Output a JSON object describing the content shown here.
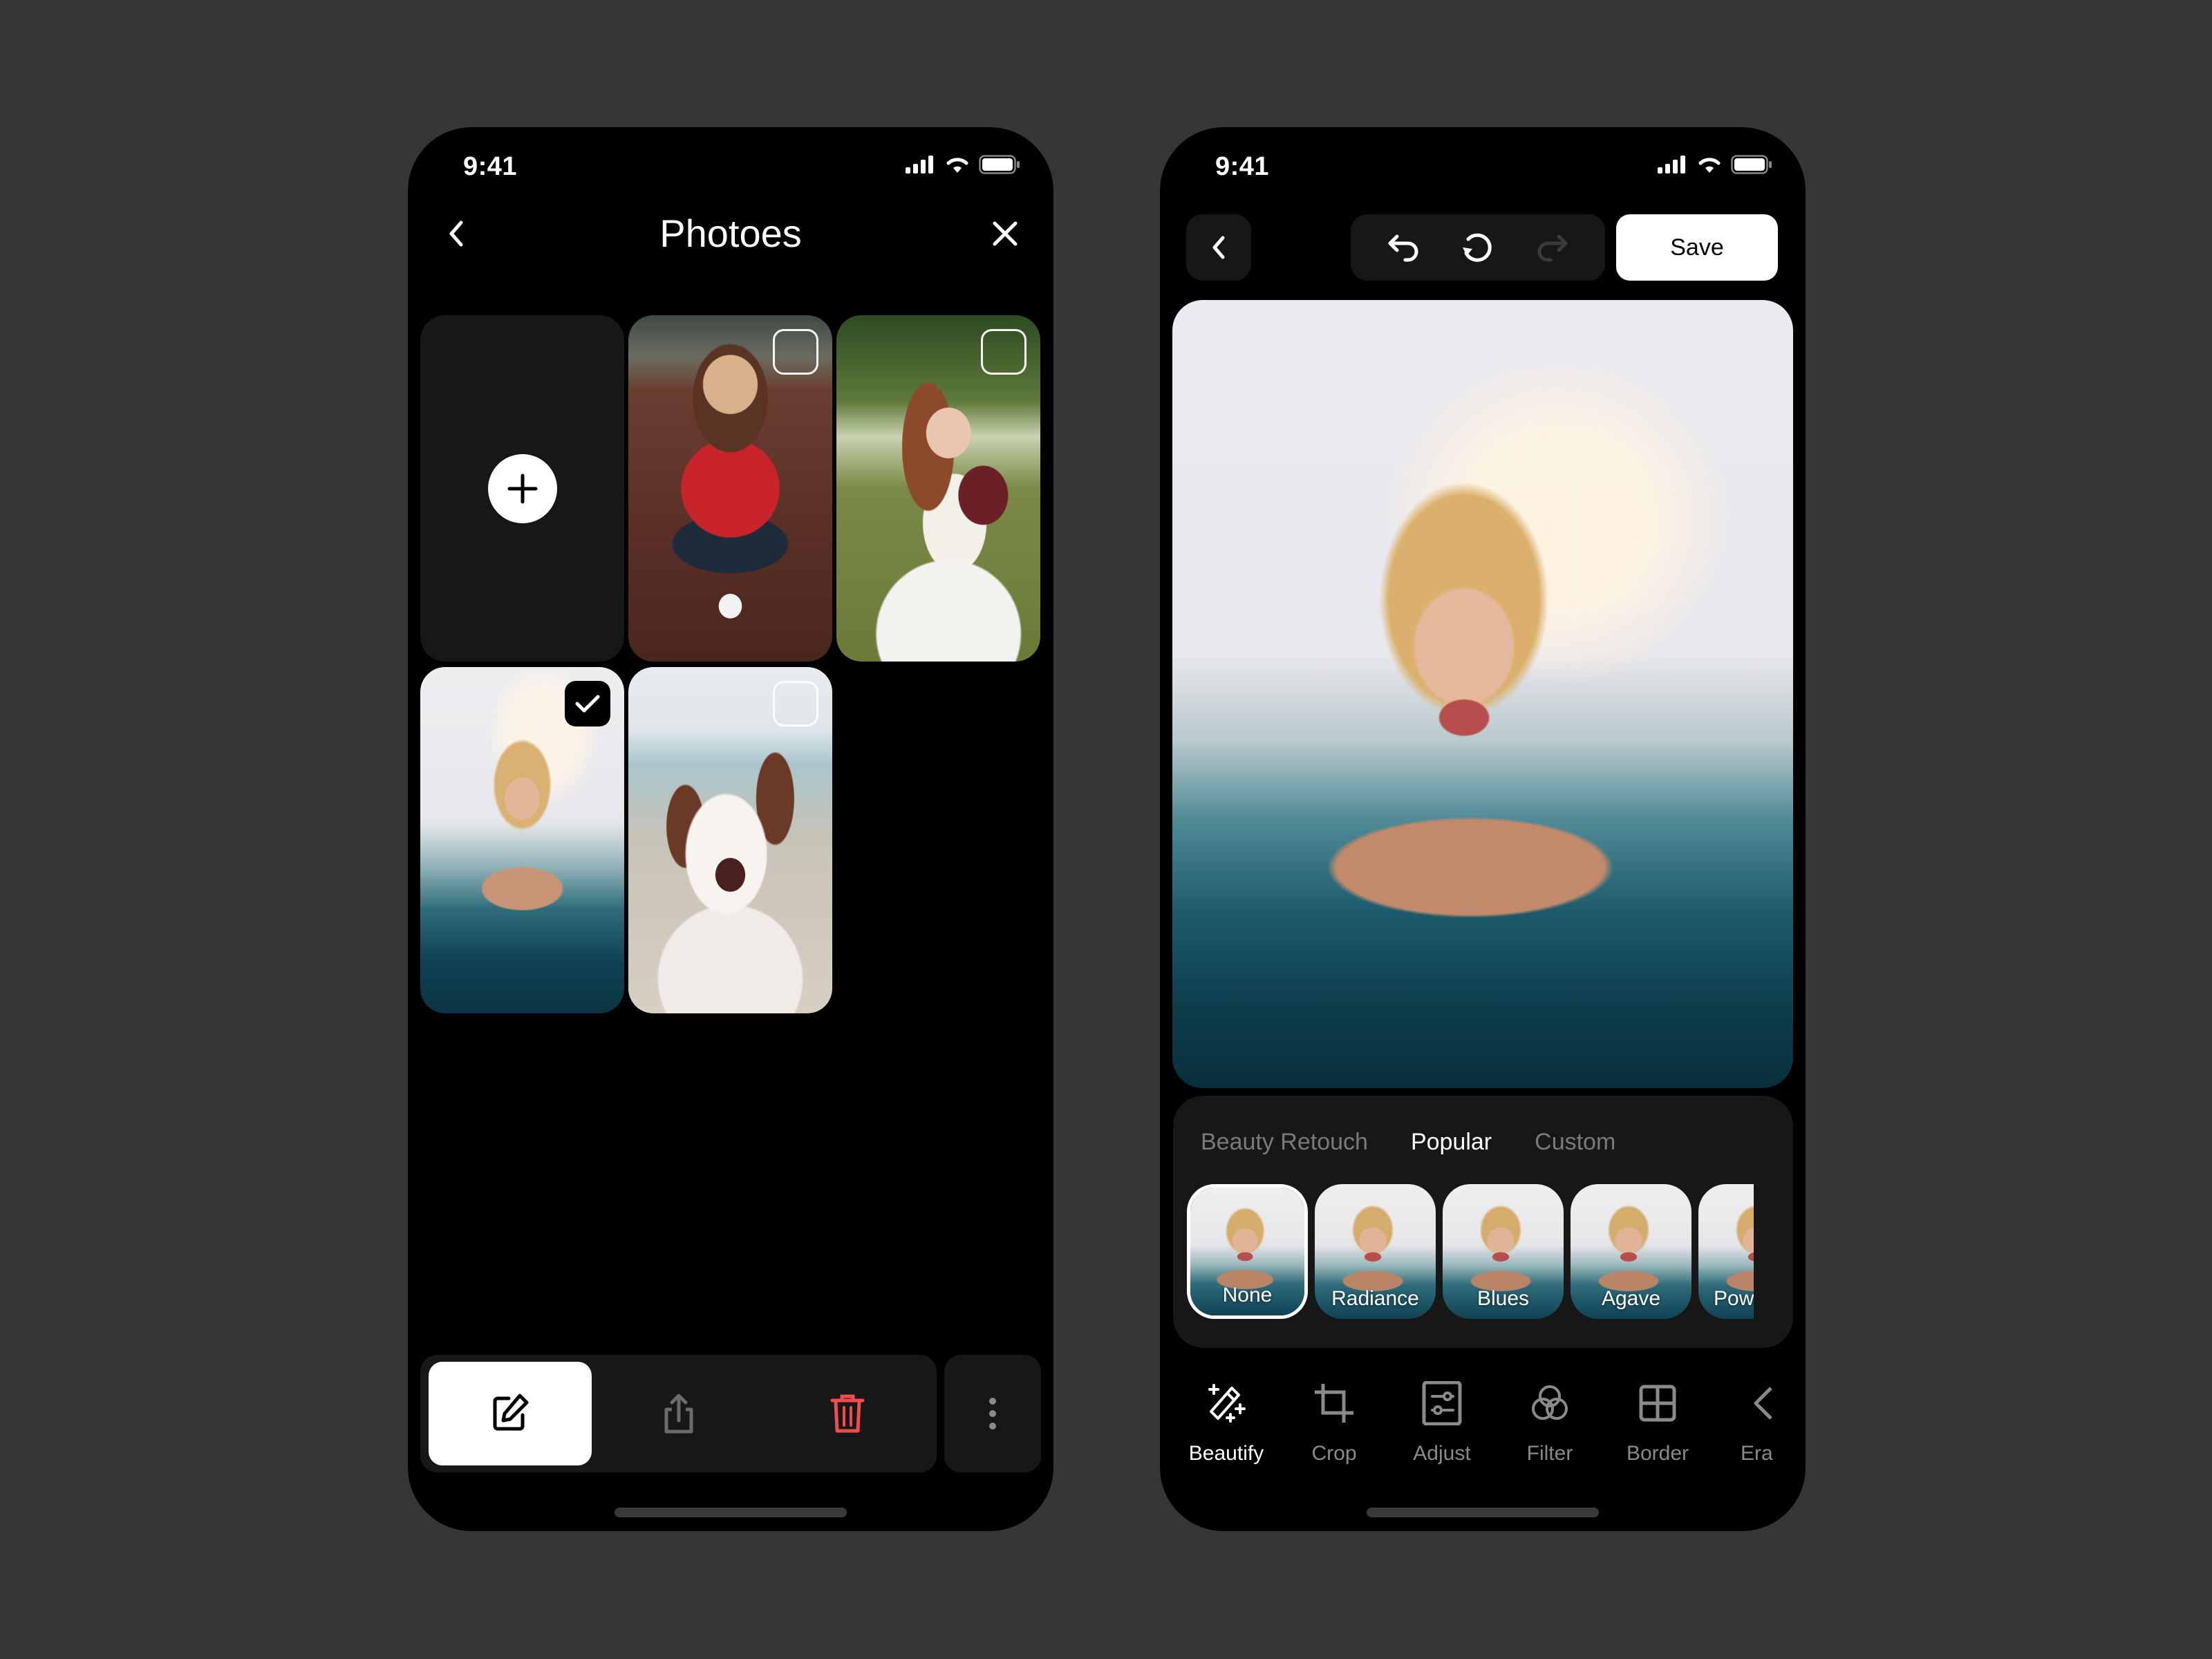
{
  "status_bar": {
    "time": "9:41",
    "icons": [
      "cellular-signal-icon",
      "wifi-icon",
      "battery-icon"
    ]
  },
  "gallery_screen": {
    "header": {
      "title": "Photoes",
      "back_icon": "chevron-left-icon",
      "close_icon": "close-icon"
    },
    "add_tile": {
      "icon": "plus-icon"
    },
    "photos": [
      {
        "subject": "girl-with-camera-on-leaves",
        "selected": false
      },
      {
        "subject": "bride-with-bouquet",
        "selected": false
      },
      {
        "subject": "woman-in-water",
        "selected": true
      },
      {
        "subject": "australian-shepherd-dog",
        "selected": false
      }
    ],
    "toolbar": {
      "actions": [
        {
          "name": "edit",
          "icon": "edit-icon",
          "active": true
        },
        {
          "name": "share",
          "icon": "share-icon",
          "active": false
        },
        {
          "name": "delete",
          "icon": "trash-icon",
          "active": false
        }
      ],
      "more_icon": "more-vertical-icon"
    },
    "colors": {
      "delete": "#ef4d4d",
      "panel": "#171717"
    }
  },
  "editor_screen": {
    "header": {
      "back_icon": "chevron-left-icon",
      "undo_icon": "undo-icon",
      "reset_icon": "rotate-ccw-icon",
      "redo_icon": "redo-icon",
      "redo_enabled": false,
      "save_label": "Save"
    },
    "main_photo": {
      "subject": "woman-in-water"
    },
    "filter_tabs": [
      {
        "label": "Beauty Retouch",
        "active": false
      },
      {
        "label": "Popular",
        "active": true
      },
      {
        "label": "Custom",
        "active": false
      }
    ],
    "filters": [
      {
        "label": "None",
        "selected": true
      },
      {
        "label": "Radiance",
        "selected": false
      },
      {
        "label": "Blues",
        "selected": false
      },
      {
        "label": "Agave",
        "selected": false
      },
      {
        "label": "Pow",
        "selected": false
      }
    ],
    "tools": [
      {
        "label": "Beautify",
        "icon": "magic-wand-icon",
        "active": true
      },
      {
        "label": "Crop",
        "icon": "crop-icon",
        "active": false
      },
      {
        "label": "Adjust",
        "icon": "sliders-icon",
        "active": false
      },
      {
        "label": "Filter",
        "icon": "filter-circles-icon",
        "active": false
      },
      {
        "label": "Border",
        "icon": "grid-icon",
        "active": false
      },
      {
        "label": "Era",
        "icon": "eraser-icon",
        "active": false
      }
    ]
  }
}
